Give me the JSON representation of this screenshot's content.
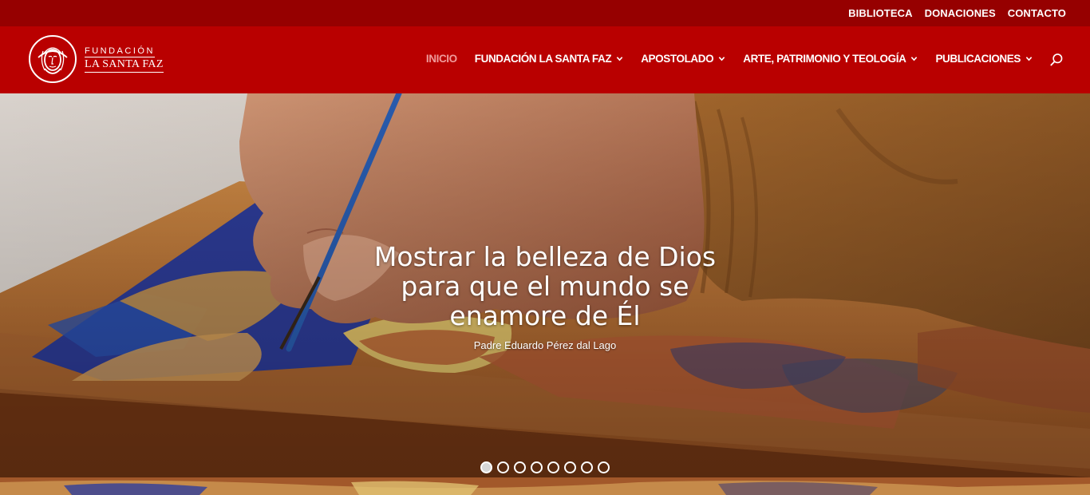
{
  "topbar": {
    "links": [
      "BIBLIOTECA",
      "DONACIONES",
      "CONTACTO"
    ]
  },
  "logo": {
    "line1": "FUNDACIÓN",
    "line2": "LA SANTA FAZ"
  },
  "menu": {
    "items": [
      {
        "label": "INICIO",
        "active": true,
        "has_dropdown": false
      },
      {
        "label": "FUNDACIÓN LA SANTA FAZ",
        "has_dropdown": true
      },
      {
        "label": "APOSTOLADO",
        "has_dropdown": true
      },
      {
        "label": "ARTE, PATRIMONIO Y TEOLOGÍA",
        "has_dropdown": true
      },
      {
        "label": "PUBLICACIONES",
        "has_dropdown": true
      }
    ],
    "search_icon": "search-icon"
  },
  "hero": {
    "title_lines": [
      "Mostrar la belleza de Dios",
      "para que el mundo se",
      "enamore de Él"
    ],
    "subtitle": "Padre Eduardo Pérez dal Lago",
    "slide_count": 8,
    "active_slide": 1
  },
  "colors": {
    "topbar": "#960000",
    "nav": "#b90000",
    "active_menu": "#ef9a9a"
  }
}
